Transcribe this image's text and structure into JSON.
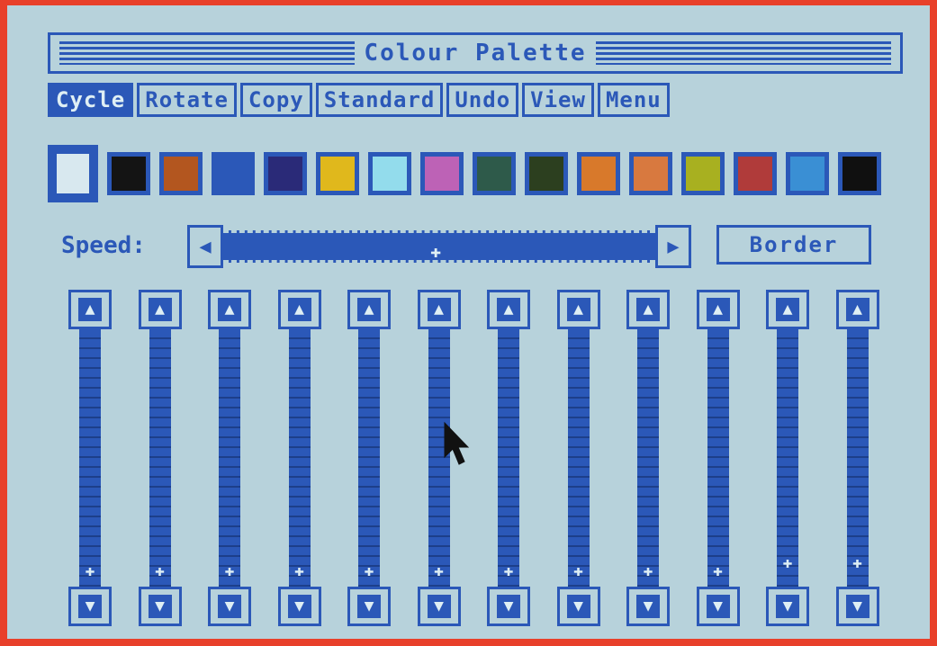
{
  "window": {
    "title": "Colour Palette"
  },
  "menu": {
    "items": [
      {
        "label": "Cycle",
        "active": true
      },
      {
        "label": "Rotate",
        "active": false
      },
      {
        "label": "Copy",
        "active": false
      },
      {
        "label": "Standard",
        "active": false
      },
      {
        "label": "Undo",
        "active": false
      },
      {
        "label": "View",
        "active": false
      },
      {
        "label": "Menu",
        "active": false
      }
    ]
  },
  "palette": {
    "selected_index": 0,
    "colors": [
      "#d8e8ef",
      "#141414",
      "#b3561f",
      "#2b58b8",
      "#2a2a78",
      "#e0b81c",
      "#93dcec",
      "#bd62b6",
      "#2e5a4a",
      "#2c3f1f",
      "#d8792b",
      "#d8793f",
      "#a8b020",
      "#b03b3a",
      "#3a8fd4",
      "#101010"
    ]
  },
  "speed": {
    "label": "Speed:",
    "value": 0.5
  },
  "border_button": {
    "label": "Border"
  },
  "sliders": {
    "count": 12,
    "levels": [
      0,
      0,
      0,
      0,
      0,
      0,
      0,
      0,
      0,
      0,
      0.03,
      0.03
    ]
  },
  "icons": {
    "left_arrow": "arrow-left-icon",
    "right_arrow": "arrow-right-icon",
    "up_arrow": "arrow-up-icon",
    "down_arrow": "arrow-down-icon",
    "cursor": "mouse-pointer-icon"
  },
  "colors": {
    "accent": "#2b58b8",
    "background": "#b7d2db",
    "frame": "#e8402a"
  }
}
